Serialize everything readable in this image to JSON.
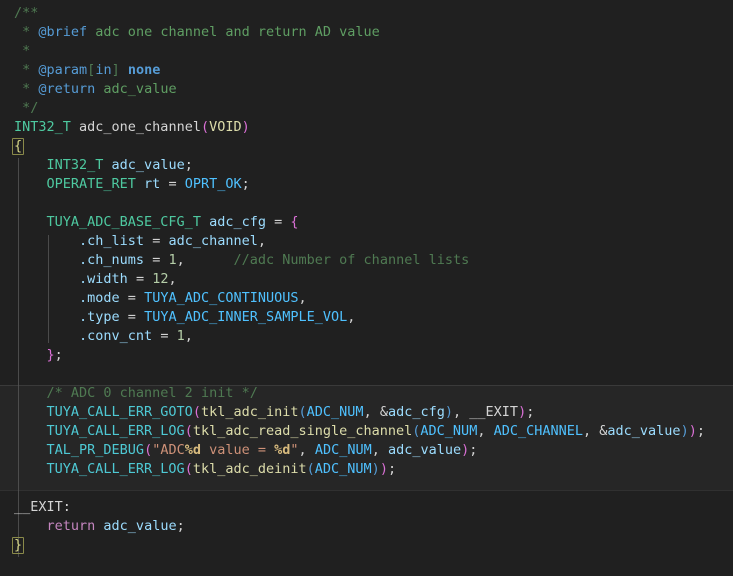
{
  "editor": {
    "language": "c",
    "background_color": "#202020",
    "default_text_color": "#d4d4d4",
    "font_size_px": 13.5,
    "line_height_px": 19
  },
  "theme_colors": {
    "comment": "#4f7a52",
    "doc_tag": "#569cd6",
    "type": "#4ec9a0",
    "variable": "#9cdcfe",
    "constant": "#4fc1ff",
    "macro": "#4ec9d4",
    "function": "#dcdcaa",
    "keyword": "#c586c0",
    "number": "#b5cea8",
    "string": "#ce9178",
    "format_specifier": "#d7ba7d",
    "bracket_level_1": "#da70d6",
    "bracket_level_2": "#569cd6",
    "bracket_level_3": "#4ec9a0",
    "brace_match_border": "#8a8a4a",
    "indent_guide": "#5a5a5a",
    "highlight_band": "#262626"
  },
  "code": {
    "lines": [
      {
        "n": 1,
        "text": "/**"
      },
      {
        "n": 2,
        "text": " * @brief adc one channel and return AD value"
      },
      {
        "n": 3,
        "text": " *"
      },
      {
        "n": 4,
        "text": " * @param[in] none"
      },
      {
        "n": 5,
        "text": " * @return adc_value"
      },
      {
        "n": 6,
        "text": " */"
      },
      {
        "n": 7,
        "text": "INT32_T adc_one_channel(VOID)"
      },
      {
        "n": 8,
        "text": "{"
      },
      {
        "n": 9,
        "text": "    INT32_T adc_value;"
      },
      {
        "n": 10,
        "text": "    OPERATE_RET rt = OPRT_OK;"
      },
      {
        "n": 11,
        "text": ""
      },
      {
        "n": 12,
        "text": "    TUYA_ADC_BASE_CFG_T adc_cfg = {"
      },
      {
        "n": 13,
        "text": "        .ch_list = adc_channel,"
      },
      {
        "n": 14,
        "text": "        .ch_nums = 1,      //adc Number of channel lists"
      },
      {
        "n": 15,
        "text": "        .width = 12,"
      },
      {
        "n": 16,
        "text": "        .mode = TUYA_ADC_CONTINUOUS,"
      },
      {
        "n": 17,
        "text": "        .type = TUYA_ADC_INNER_SAMPLE_VOL,"
      },
      {
        "n": 18,
        "text": "        .conv_cnt = 1,"
      },
      {
        "n": 19,
        "text": "    };"
      },
      {
        "n": 20,
        "text": ""
      },
      {
        "n": 21,
        "text": "    /* ADC 0 channel 2 init */"
      },
      {
        "n": 22,
        "text": "    TUYA_CALL_ERR_GOTO(tkl_adc_init(ADC_NUM, &adc_cfg), __EXIT);"
      },
      {
        "n": 23,
        "text": "    TUYA_CALL_ERR_LOG(tkl_adc_read_single_channel(ADC_NUM, ADC_CHANNEL, &adc_value));"
      },
      {
        "n": 24,
        "text": "    TAL_PR_DEBUG(\"ADC%d value = %d\", ADC_NUM, adc_value);"
      },
      {
        "n": 25,
        "text": "    TUYA_CALL_ERR_LOG(tkl_adc_deinit(ADC_NUM));"
      },
      {
        "n": 26,
        "text": ""
      },
      {
        "n": 27,
        "text": "__EXIT:"
      },
      {
        "n": 28,
        "text": "    return adc_value;"
      },
      {
        "n": 29,
        "text": "}"
      }
    ],
    "tokens": {
      "l1_comment": "/**",
      "l2_star": " * ",
      "l2_tag": "@brief",
      "l2_text": " adc one channel and return AD value",
      "l3_star": " *",
      "l4_star": " * ",
      "l4_tag": "@param",
      "l4_brk_open": "[",
      "l4_brk_in": "in",
      "l4_brk_close": "]",
      "l4_none": " none",
      "l5_star": " * ",
      "l5_tag": "@return",
      "l5_text": " adc_value",
      "l6_comment": " */",
      "l7_type": "INT32_T",
      "l7_func": " adc_one_channel",
      "l7_paren_open": "(",
      "l7_void": "VOID",
      "l7_paren_close": ")",
      "l8_brace": "{",
      "l9_indent": "    ",
      "l9_type": "INT32_T",
      "l9_var": " adc_value",
      "l9_semi": ";",
      "l10_indent": "    ",
      "l10_type": "OPERATE_RET",
      "l10_var": " rt",
      "l10_eq": " = ",
      "l10_const": "OPRT_OK",
      "l10_semi": ";",
      "l12_indent": "    ",
      "l12_type": "TUYA_ADC_BASE_CFG_T",
      "l12_var": " adc_cfg",
      "l12_eq": " = ",
      "l12_brace": "{",
      "l13_indent": "        ",
      "l13_field": ".ch_list",
      "l13_eq": " = ",
      "l13_var": "adc_channel",
      "l13_comma": ",",
      "l14_indent": "        ",
      "l14_field": ".ch_nums",
      "l14_eq": " = ",
      "l14_num": "1",
      "l14_comma": ",",
      "l14_gap": "      ",
      "l14_comment": "//adc Number of channel lists",
      "l15_indent": "        ",
      "l15_field": ".width",
      "l15_eq": " = ",
      "l15_num": "12",
      "l15_comma": ",",
      "l16_indent": "        ",
      "l16_field": ".mode",
      "l16_eq": " = ",
      "l16_enum": "TUYA_ADC_CONTINUOUS",
      "l16_comma": ",",
      "l17_indent": "        ",
      "l17_field": ".type",
      "l17_eq": " = ",
      "l17_enum": "TUYA_ADC_INNER_SAMPLE_VOL",
      "l17_comma": ",",
      "l18_indent": "        ",
      "l18_field": ".conv_cnt",
      "l18_eq": " = ",
      "l18_num": "1",
      "l18_comma": ",",
      "l19_indent": "    ",
      "l19_brace": "}",
      "l19_semi": ";",
      "l21_indent": "    ",
      "l21_comment": "/* ADC 0 channel 2 init */",
      "l22_indent": "    ",
      "l22_macro": "TUYA_CALL_ERR_GOTO",
      "l22_p1o": "(",
      "l22_func": "tkl_adc_init",
      "l22_p2o": "(",
      "l22_const": "ADC_NUM",
      "l22_comma1": ", ",
      "l22_amp": "&",
      "l22_var": "adc_cfg",
      "l22_p2c": ")",
      "l22_comma2": ", ",
      "l22_label": "__EXIT",
      "l22_p1c": ")",
      "l22_semi": ";",
      "l23_indent": "    ",
      "l23_macro": "TUYA_CALL_ERR_LOG",
      "l23_p1o": "(",
      "l23_func": "tkl_adc_read_single_channel",
      "l23_p2o": "(",
      "l23_const1": "ADC_NUM",
      "l23_comma1": ", ",
      "l23_const2": "ADC_CHANNEL",
      "l23_comma2": ", ",
      "l23_amp": "&",
      "l23_var": "adc_value",
      "l23_p2c": ")",
      "l23_p1c": ")",
      "l23_semi": ";",
      "l24_indent": "    ",
      "l24_macro": "TAL_PR_DEBUG",
      "l24_p1o": "(",
      "l24_str1": "\"ADC",
      "l24_fmt1": "%d",
      "l24_str2": " value = ",
      "l24_fmt2": "%d",
      "l24_str3": "\"",
      "l24_comma1": ", ",
      "l24_const": "ADC_NUM",
      "l24_comma2": ", ",
      "l24_var": "adc_value",
      "l24_p1c": ")",
      "l24_semi": ";",
      "l25_indent": "    ",
      "l25_macro": "TUYA_CALL_ERR_LOG",
      "l25_p1o": "(",
      "l25_func": "tkl_adc_deinit",
      "l25_p2o": "(",
      "l25_const": "ADC_NUM",
      "l25_p2c": ")",
      "l25_p1c": ")",
      "l25_semi": ";",
      "l27_label": "__EXIT:",
      "l28_indent": "    ",
      "l28_keyword": "return",
      "l28_var": " adc_value",
      "l28_semi": ";",
      "l29_brace": "}"
    }
  }
}
